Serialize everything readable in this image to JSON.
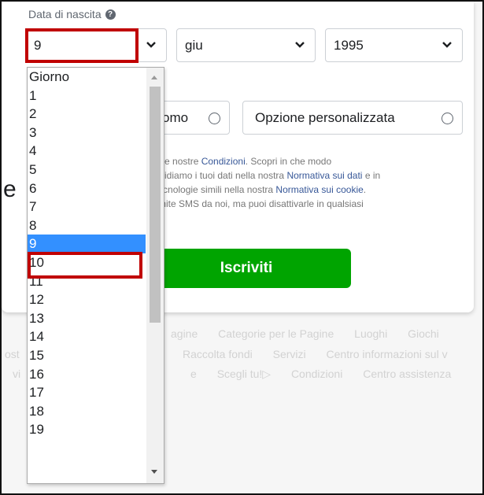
{
  "dob": {
    "label": "Data di nascita",
    "help_icon": "question-icon",
    "day_value": "9",
    "month_value": "giu",
    "year_value": "1995"
  },
  "gender": {
    "option1_label": "omo",
    "option2_label": "Opzione personalizzata"
  },
  "terms": {
    "line1_pre": "etti le nostre ",
    "line1_link": "Condizioni",
    "line1_post": ". Scopri in che modo",
    "line2_pre": "ndividiamo i tuoi dati nella nostra ",
    "line2_link": "Normativa sui dati",
    "line2_post": " e in",
    "line3_pre": "e tecnologie simili nella nostra ",
    "line3_link": "Normativa sui cookie",
    "line3_post": ".",
    "line4": "tramite SMS da noi, ma puoi disattivarle in qualsiasi"
  },
  "stray_text": "e",
  "signup_button": "Iscriviti",
  "footer": {
    "row1": [
      "agine",
      "Categorie per le Pagine",
      "Luoghi",
      "Giochi"
    ],
    "row2_lead": "ost",
    "row2": [
      "Raccolta fondi",
      "Servizi",
      "Centro informazioni sul v"
    ],
    "row3_lead": "vi",
    "row3": [
      "e",
      "Scegli tu!▷",
      "Condizioni",
      "Centro assistenza"
    ]
  },
  "day_options": [
    "Giorno",
    "1",
    "2",
    "3",
    "4",
    "5",
    "6",
    "7",
    "8",
    "9",
    "10",
    "11",
    "12",
    "13",
    "14",
    "15",
    "16",
    "17",
    "18",
    "19"
  ],
  "selected_day_index": 9,
  "colors": {
    "highlight": "#c00000",
    "selected_bg": "#3390ff",
    "signup_green": "#00a400",
    "link": "#385898"
  }
}
